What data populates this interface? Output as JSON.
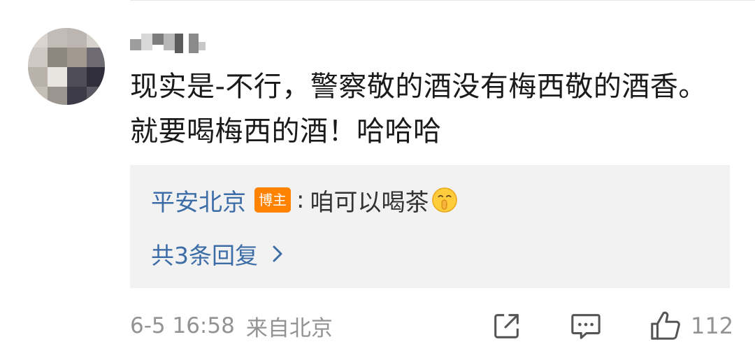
{
  "comment": {
    "username": "",
    "text": "现实是-不行，警察敬的酒没有梅西敬的酒香。就要喝梅西的酒！哈哈哈",
    "reply": {
      "author": "平安北京",
      "badge": "博主",
      "colon": ":",
      "text": "咱可以喝茶",
      "emoji": "shushing-face-emoji"
    },
    "more_replies_label": "共3条回复",
    "timestamp": "6-5 16:58",
    "location": "来自北京",
    "like_count": "112"
  },
  "colors": {
    "link_blue": "#3d6da7",
    "badge_orange": "#ff8200",
    "meta_gray": "#939393",
    "reply_bg": "#f2f2f2"
  }
}
